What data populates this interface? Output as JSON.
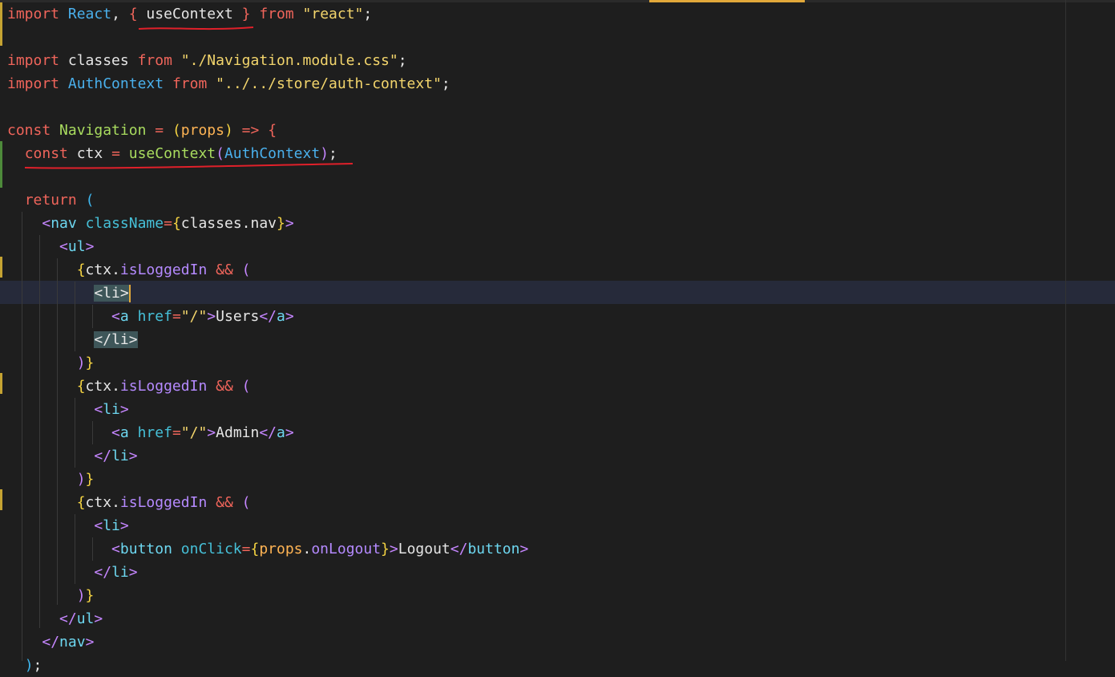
{
  "editor": {
    "lines": [
      [
        [
          "k",
          "import"
        ],
        [
          "t",
          " "
        ],
        [
          "c",
          "React"
        ],
        [
          "p",
          ", "
        ],
        [
          "br4",
          "{"
        ],
        [
          "t",
          " useContext "
        ],
        [
          "br4",
          "}"
        ],
        [
          "t",
          " "
        ],
        [
          "k",
          "from"
        ],
        [
          "t",
          " "
        ],
        [
          "s",
          "\"react\""
        ],
        [
          "p",
          ";"
        ]
      ],
      [],
      [
        [
          "k",
          "import"
        ],
        [
          "t",
          " classes "
        ],
        [
          "k",
          "from"
        ],
        [
          "t",
          " "
        ],
        [
          "s",
          "\"./Navigation.module.css\""
        ],
        [
          "p",
          ";"
        ]
      ],
      [
        [
          "k",
          "import"
        ],
        [
          "t",
          " "
        ],
        [
          "c",
          "AuthContext"
        ],
        [
          "t",
          " "
        ],
        [
          "k",
          "from"
        ],
        [
          "t",
          " "
        ],
        [
          "s",
          "\"../../store/auth-context\""
        ],
        [
          "p",
          ";"
        ]
      ],
      [],
      [
        [
          "k",
          "const"
        ],
        [
          "t",
          " "
        ],
        [
          "f",
          "Navigation"
        ],
        [
          "t",
          " "
        ],
        [
          "o",
          "="
        ],
        [
          "t",
          " "
        ],
        [
          "br1",
          "("
        ],
        [
          "pm",
          "props"
        ],
        [
          "br1",
          ")"
        ],
        [
          "t",
          " "
        ],
        [
          "o",
          "=>"
        ],
        [
          "t",
          " "
        ],
        [
          "br4",
          "{"
        ]
      ],
      [
        [
          "t",
          "  "
        ],
        [
          "k",
          "const"
        ],
        [
          "t",
          " ctx "
        ],
        [
          "o",
          "="
        ],
        [
          "t",
          " "
        ],
        [
          "f",
          "useContext"
        ],
        [
          "br2",
          "("
        ],
        [
          "c",
          "AuthContext"
        ],
        [
          "br2",
          ")"
        ],
        [
          "p",
          ";"
        ]
      ],
      [],
      [
        [
          "t",
          "  "
        ],
        [
          "k",
          "return"
        ],
        [
          "t",
          " "
        ],
        [
          "br3",
          "("
        ]
      ],
      [
        [
          "t",
          "    "
        ],
        [
          "tag",
          "<"
        ],
        [
          "tn",
          "nav"
        ],
        [
          "t",
          " "
        ],
        [
          "at",
          "className"
        ],
        [
          "o",
          "="
        ],
        [
          "br1",
          "{"
        ],
        [
          "t",
          "classes"
        ],
        [
          "p",
          "."
        ],
        [
          "t",
          "nav"
        ],
        [
          "br1",
          "}"
        ],
        [
          "tag",
          ">"
        ]
      ],
      [
        [
          "t",
          "      "
        ],
        [
          "tag",
          "<"
        ],
        [
          "tn",
          "ul"
        ],
        [
          "tag",
          ">"
        ]
      ],
      [
        [
          "t",
          "        "
        ],
        [
          "br1",
          "{"
        ],
        [
          "t",
          "ctx"
        ],
        [
          "p",
          "."
        ],
        [
          "pr",
          "isLoggedIn"
        ],
        [
          "t",
          " "
        ],
        [
          "o",
          "&&"
        ],
        [
          "t",
          " "
        ],
        [
          "br2",
          "("
        ]
      ],
      [
        [
          "t",
          "          "
        ],
        [
          "sel",
          "<"
        ],
        [
          "sel",
          "li"
        ],
        [
          "sel",
          ">"
        ]
      ],
      [
        [
          "t",
          "            "
        ],
        [
          "tag",
          "<"
        ],
        [
          "tn",
          "a"
        ],
        [
          "t",
          " "
        ],
        [
          "at",
          "href"
        ],
        [
          "o",
          "="
        ],
        [
          "s",
          "\"/\""
        ],
        [
          "tag",
          ">"
        ],
        [
          "t",
          "Users"
        ],
        [
          "tag",
          "</"
        ],
        [
          "tn",
          "a"
        ],
        [
          "tag",
          ">"
        ]
      ],
      [
        [
          "t",
          "          "
        ],
        [
          "sel",
          "</"
        ],
        [
          "sel",
          "li"
        ],
        [
          "sel",
          ">"
        ]
      ],
      [
        [
          "t",
          "        "
        ],
        [
          "br2",
          ")"
        ],
        [
          "br1",
          "}"
        ]
      ],
      [
        [
          "t",
          "        "
        ],
        [
          "br1",
          "{"
        ],
        [
          "t",
          "ctx"
        ],
        [
          "p",
          "."
        ],
        [
          "pr",
          "isLoggedIn"
        ],
        [
          "t",
          " "
        ],
        [
          "o",
          "&&"
        ],
        [
          "t",
          " "
        ],
        [
          "br2",
          "("
        ]
      ],
      [
        [
          "t",
          "          "
        ],
        [
          "tag",
          "<"
        ],
        [
          "tn",
          "li"
        ],
        [
          "tag",
          ">"
        ]
      ],
      [
        [
          "t",
          "            "
        ],
        [
          "tag",
          "<"
        ],
        [
          "tn",
          "a"
        ],
        [
          "t",
          " "
        ],
        [
          "at",
          "href"
        ],
        [
          "o",
          "="
        ],
        [
          "s",
          "\"/\""
        ],
        [
          "tag",
          ">"
        ],
        [
          "t",
          "Admin"
        ],
        [
          "tag",
          "</"
        ],
        [
          "tn",
          "a"
        ],
        [
          "tag",
          ">"
        ]
      ],
      [
        [
          "t",
          "          "
        ],
        [
          "tag",
          "</"
        ],
        [
          "tn",
          "li"
        ],
        [
          "tag",
          ">"
        ]
      ],
      [
        [
          "t",
          "        "
        ],
        [
          "br2",
          ")"
        ],
        [
          "br1",
          "}"
        ]
      ],
      [
        [
          "t",
          "        "
        ],
        [
          "br1",
          "{"
        ],
        [
          "t",
          "ctx"
        ],
        [
          "p",
          "."
        ],
        [
          "pr",
          "isLoggedIn"
        ],
        [
          "t",
          " "
        ],
        [
          "o",
          "&&"
        ],
        [
          "t",
          " "
        ],
        [
          "br2",
          "("
        ]
      ],
      [
        [
          "t",
          "          "
        ],
        [
          "tag",
          "<"
        ],
        [
          "tn",
          "li"
        ],
        [
          "tag",
          ">"
        ]
      ],
      [
        [
          "t",
          "            "
        ],
        [
          "tag",
          "<"
        ],
        [
          "tn",
          "button"
        ],
        [
          "t",
          " "
        ],
        [
          "at",
          "onClick"
        ],
        [
          "o",
          "="
        ],
        [
          "br1",
          "{"
        ],
        [
          "pm",
          "props"
        ],
        [
          "p",
          "."
        ],
        [
          "pr",
          "onLogout"
        ],
        [
          "br1",
          "}"
        ],
        [
          "tag",
          ">"
        ],
        [
          "t",
          "Logout"
        ],
        [
          "tag",
          "</"
        ],
        [
          "tn",
          "button"
        ],
        [
          "tag",
          ">"
        ]
      ],
      [
        [
          "t",
          "          "
        ],
        [
          "tag",
          "</"
        ],
        [
          "tn",
          "li"
        ],
        [
          "tag",
          ">"
        ]
      ],
      [
        [
          "t",
          "        "
        ],
        [
          "br2",
          ")"
        ],
        [
          "br1",
          "}"
        ]
      ],
      [
        [
          "t",
          "      "
        ],
        [
          "tag",
          "</"
        ],
        [
          "tn",
          "ul"
        ],
        [
          "tag",
          ">"
        ]
      ],
      [
        [
          "t",
          "    "
        ],
        [
          "tag",
          "</"
        ],
        [
          "tn",
          "nav"
        ],
        [
          "tag",
          ">"
        ]
      ],
      [
        [
          "t",
          "  "
        ],
        [
          "br3",
          ")"
        ],
        [
          "p",
          ";"
        ]
      ]
    ],
    "colors": {
      "background": "#1e1e1e",
      "current_line": "#262a3a",
      "selection": "#3e5659",
      "annotation_underline": "#e0202a",
      "cursor": "#e2a83a"
    },
    "current_line_index": 12
  }
}
